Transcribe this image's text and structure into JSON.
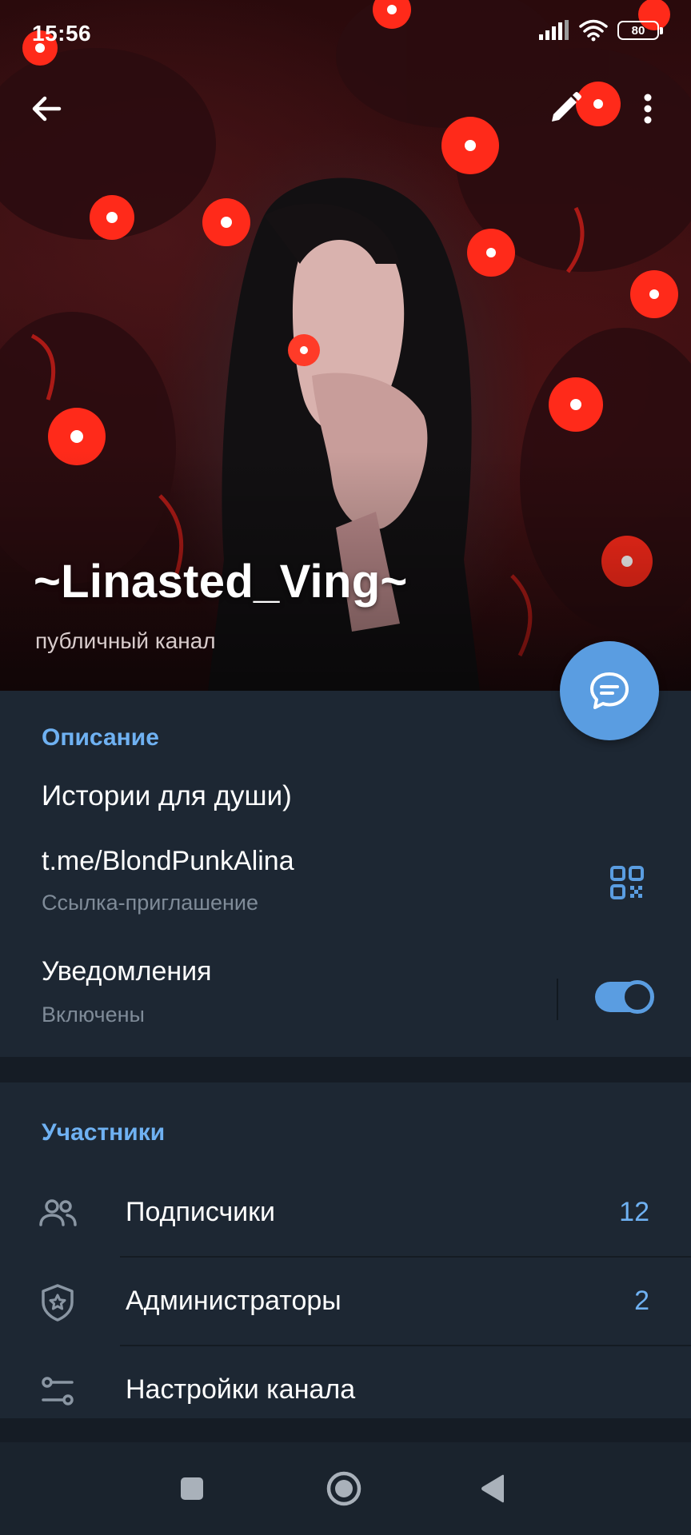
{
  "status_bar": {
    "time": "15:56",
    "battery": "80",
    "icons": [
      "signal-icon",
      "wifi-icon",
      "battery-icon"
    ]
  },
  "header": {
    "title": "~Linasted_Ving~",
    "subtitle": "публичный канал",
    "actions": [
      "back-arrow-icon",
      "pencil-icon",
      "more-vert-icon"
    ],
    "fab_icon": "chat-bubble-icon"
  },
  "info": {
    "section_title": "Описание",
    "description": "Истории для души)",
    "link": "t.me/BlondPunkAlina",
    "link_caption": "Ссылка-приглашение",
    "notifications_label": "Уведомления",
    "notifications_state": "Включены",
    "notifications_enabled": true
  },
  "members": {
    "section_title": "Участники",
    "items": [
      {
        "label": "Подписчики",
        "count": "12",
        "icon": "people-icon"
      },
      {
        "label": "Администраторы",
        "count": "2",
        "icon": "shield-star-icon"
      },
      {
        "label": "Настройки канала",
        "count": "",
        "icon": "sliders-icon"
      }
    ]
  },
  "navbar": {
    "buttons": [
      "recents-square-icon",
      "home-circle-icon",
      "back-triangle-icon"
    ]
  },
  "colors": {
    "accent": "#5a9de1",
    "link_blue": "#6fb1f2",
    "background": "#1d2733",
    "secondary_text": "#7f8b98"
  }
}
